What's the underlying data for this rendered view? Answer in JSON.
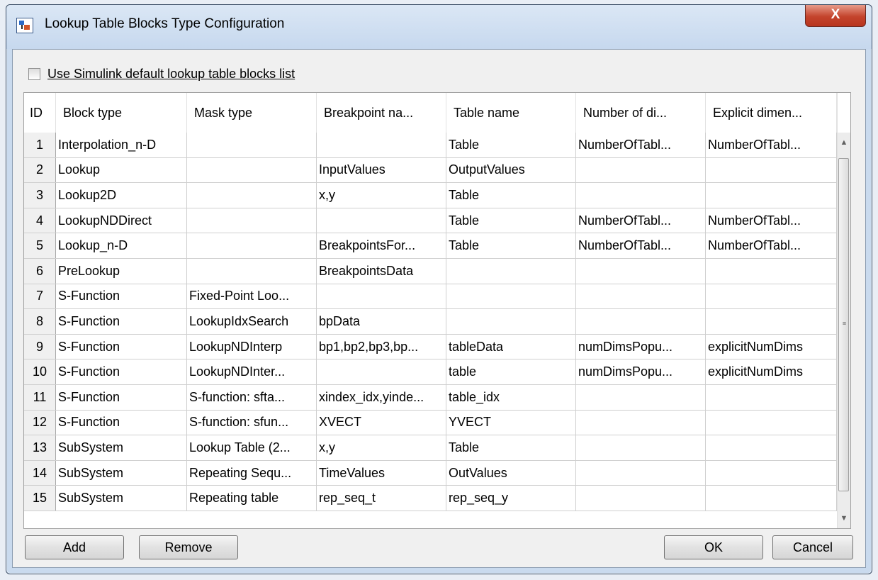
{
  "window": {
    "title": "Lookup Table Blocks Type Configuration",
    "close_label": "X"
  },
  "checkbox": {
    "label": "Use Simulink default lookup table blocks list",
    "checked": false
  },
  "table": {
    "columns": [
      "ID",
      "Block type",
      "Mask type",
      "Breakpoint na...",
      "Table name",
      "Number of di...",
      "Explicit dimen..."
    ],
    "rows": [
      [
        "1",
        "Interpolation_n-D",
        "",
        "",
        "Table",
        "NumberOfTabl...",
        "NumberOfTabl..."
      ],
      [
        "2",
        "Lookup",
        "",
        "InputValues",
        "OutputValues",
        "",
        ""
      ],
      [
        "3",
        "Lookup2D",
        "",
        "x,y",
        "Table",
        "",
        ""
      ],
      [
        "4",
        "LookupNDDirect",
        "",
        "",
        "Table",
        "NumberOfTabl...",
        "NumberOfTabl..."
      ],
      [
        "5",
        "Lookup_n-D",
        "",
        "BreakpointsFor...",
        "Table",
        "NumberOfTabl...",
        "NumberOfTabl..."
      ],
      [
        "6",
        "PreLookup",
        "",
        "BreakpointsData",
        "",
        "",
        ""
      ],
      [
        "7",
        "S-Function",
        "Fixed-Point Loo...",
        "",
        "",
        "",
        ""
      ],
      [
        "8",
        "S-Function",
        "LookupIdxSearch",
        "bpData",
        "",
        "",
        ""
      ],
      [
        "9",
        "S-Function",
        "LookupNDInterp",
        "bp1,bp2,bp3,bp...",
        "tableData",
        "numDimsPopu...",
        "explicitNumDims"
      ],
      [
        "10",
        "S-Function",
        "LookupNDInter...",
        "",
        "table",
        "numDimsPopu...",
        "explicitNumDims"
      ],
      [
        "11",
        "S-Function",
        "S-function: sfta...",
        "xindex_idx,yinde...",
        "table_idx",
        "",
        ""
      ],
      [
        "12",
        "S-Function",
        "S-function: sfun...",
        "XVECT",
        "YVECT",
        "",
        ""
      ],
      [
        "13",
        "SubSystem",
        "Lookup Table (2...",
        "x,y",
        "Table",
        "",
        ""
      ],
      [
        "14",
        "SubSystem",
        "Repeating Sequ...",
        "TimeValues",
        "OutValues",
        "",
        ""
      ],
      [
        "15",
        "SubSystem",
        "Repeating table",
        "rep_seq_t",
        "rep_seq_y",
        "",
        ""
      ]
    ]
  },
  "scrollbar": {
    "up_icon": "▲",
    "down_icon": "▼",
    "grip_icon": "≡"
  },
  "buttons": {
    "add": "Add",
    "remove": "Remove",
    "ok": "OK",
    "cancel": "Cancel"
  }
}
